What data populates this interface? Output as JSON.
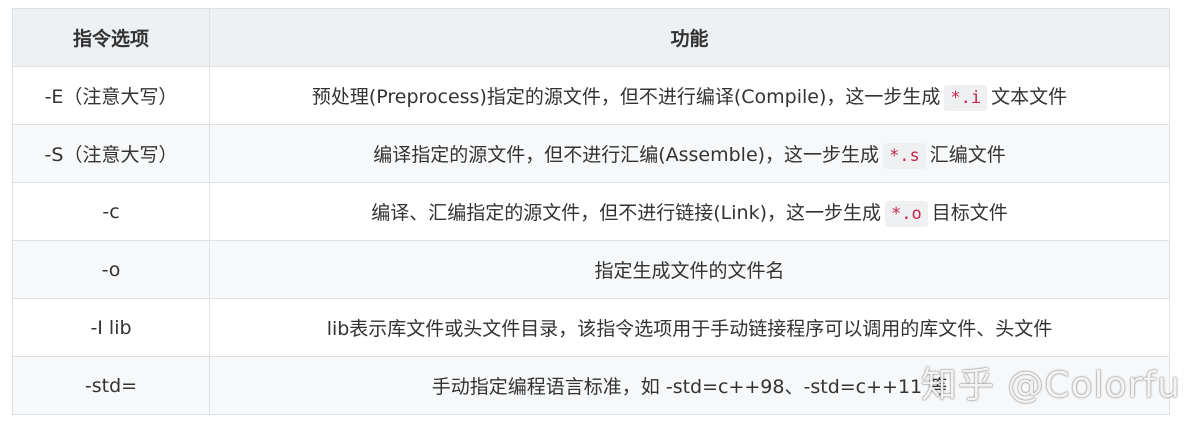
{
  "table": {
    "headers": [
      "指令选项",
      "功能"
    ],
    "rows": [
      {
        "option": "-E（注意大写）",
        "before": "预处理(Preprocess)指定的源文件，但不进行编译(Compile)，这一步生成",
        "code": "*.i",
        "after": "文本文件"
      },
      {
        "option": "-S（注意大写）",
        "before": "编译指定的源文件，但不进行汇编(Assemble)，这一步生成",
        "code": "*.s",
        "after": "汇编文件"
      },
      {
        "option": "-c",
        "before": "编译、汇编指定的源文件，但不进行链接(Link)，这一步生成",
        "code": "*.o",
        "after": "目标文件"
      },
      {
        "option": "-o",
        "before": "指定生成文件的文件名",
        "code": "",
        "after": ""
      },
      {
        "option": "-I lib",
        "before": "lib表示库文件或头文件目录，该指令选项用于手动链接程序可以调用的库文件、头文件",
        "code": "",
        "after": ""
      },
      {
        "option": "-std=",
        "before": "手动指定编程语言标准，如 -std=c++98、-std=c++11 等",
        "code": "",
        "after": ""
      }
    ]
  },
  "watermark": "知乎 @Colorful"
}
